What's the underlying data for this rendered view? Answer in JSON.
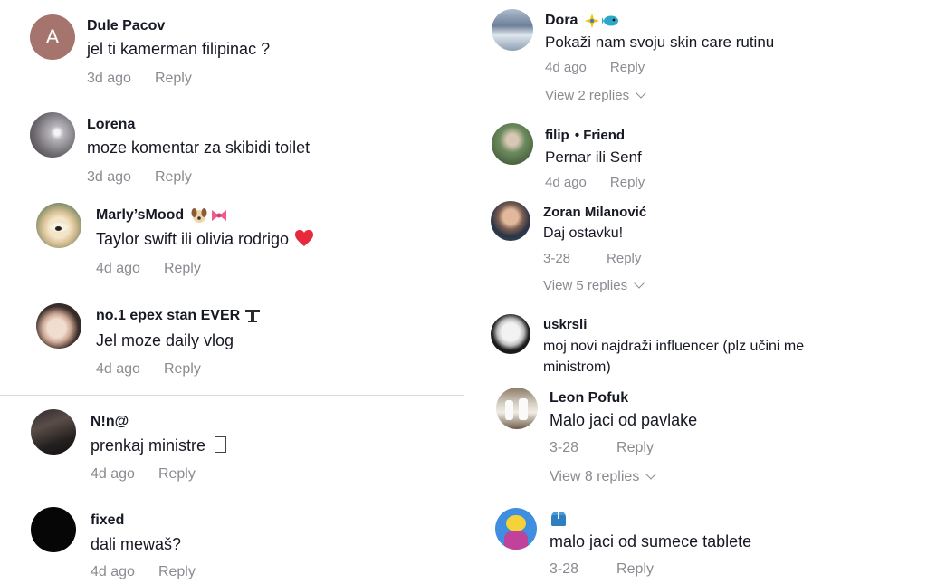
{
  "left_comments": [
    {
      "username": "Dule Pacov",
      "text": "jel ti kamerman filipinac ?",
      "time": "3d ago",
      "reply": "Reply",
      "avatar_letter": "A"
    },
    {
      "username": "Lorena",
      "text": "moze komentar za skibidi toilet",
      "time": "3d ago",
      "reply": "Reply"
    },
    {
      "username": "Marly’sMood",
      "text": "Taylor swift ili olivia rodrigo",
      "time": "4d ago",
      "reply": "Reply"
    },
    {
      "username": "no.1 epex stan EVER",
      "text": "Jel moze daily vlog",
      "time": "4d ago",
      "reply": "Reply"
    },
    {
      "username": "N!n@",
      "text": "prenkaj ministre",
      "time": "4d ago",
      "reply": "Reply"
    },
    {
      "username": "fixed",
      "text": "dali mewaš?",
      "time": "4d ago",
      "reply": "Reply"
    }
  ],
  "right_comments": [
    {
      "username": "Dora",
      "text": "Pokaži nam svoju skin care rutinu",
      "time": "4d ago",
      "reply": "Reply",
      "view_replies": "View 2 replies"
    },
    {
      "username": "filip",
      "friend_badge": "• Friend",
      "text": "Pernar ili Senf",
      "time": "4d ago",
      "reply": "Reply"
    },
    {
      "username": "Zoran Milanović",
      "text": "Daj ostavku!",
      "time": "3-28",
      "reply": "Reply",
      "view_replies": "View 5 replies"
    },
    {
      "username": "uskrsli",
      "text_line1": "moj novi najdraži influencer (plz učini me",
      "text_line2": "ministrom)"
    },
    {
      "username": "Leon Pofuk",
      "text": "Malo jaci od pavlake",
      "time": "3-28",
      "reply": "Reply",
      "view_replies": "View 8 replies"
    },
    {
      "username": "",
      "text": "malo jaci od sumece tablete",
      "time": "3-28",
      "reply": "Reply"
    }
  ],
  "colors": {
    "text": "#161823",
    "muted": "#8a8b91",
    "divider": "#dcdcdc",
    "heart": "#e8283c"
  }
}
